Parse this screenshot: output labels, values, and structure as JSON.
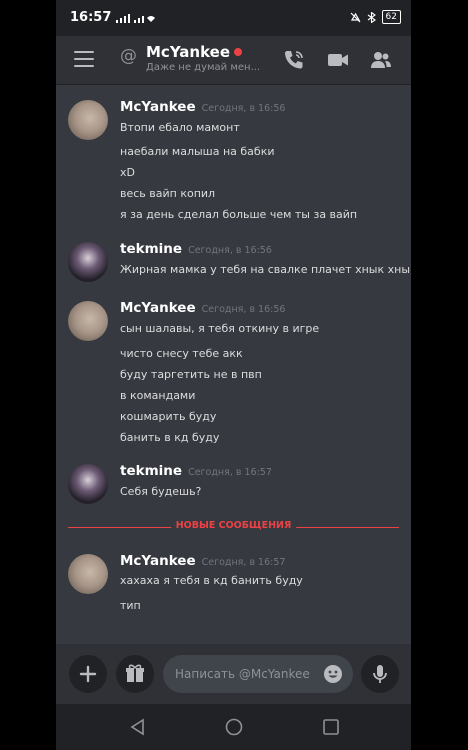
{
  "status_bar": {
    "time": "16:57",
    "battery": "62"
  },
  "header": {
    "at_symbol": "@",
    "username": "McYankee",
    "status_text": "Даже не думай мен..."
  },
  "messages": [
    {
      "author": "McYankee",
      "timestamp": "Сегодня, в 16:56",
      "avatar": "mcyankee-avatar",
      "lines": [
        "Втопи ебало мамонт",
        "наебали малыша на бабки",
        "xD",
        "весь вайп копил",
        "я за день сделал больше чем ты за вайп"
      ]
    },
    {
      "author": "tekmine",
      "timestamp": "Сегодня, в 16:56",
      "avatar": "tekmine-avatar",
      "lines": [
        "Жирная мамка у тебя на свалке плачет хнык хнык"
      ]
    },
    {
      "author": "McYankee",
      "timestamp": "Сегодня, в 16:56",
      "avatar": "mcyankee-avatar",
      "lines": [
        "сын шалавы, я тебя откину в игре",
        "чисто снесу тебе акк",
        "буду таргетить не в пвп",
        "в командами",
        "кошмарить буду",
        "банить в кд буду"
      ]
    },
    {
      "author": "tekmine",
      "timestamp": "Сегодня, в 16:57",
      "avatar": "tekmine-avatar",
      "lines": [
        "Себя будешь?"
      ]
    },
    {
      "author": "McYankee",
      "timestamp": "Сегодня, в 16:57",
      "avatar": "mcyankee-avatar",
      "lines": [
        "хахаха я тебя в кд банить буду",
        "тип"
      ]
    }
  ],
  "new_messages_divider": "НОВЫЕ СООБЩЕНИЯ",
  "composer": {
    "placeholder": "Написать @McYankee"
  },
  "colors": {
    "background": "#36393f",
    "header": "#2f3136",
    "dnd": "#ed4245",
    "divider": "#ed4245"
  },
  "icons": {
    "header": [
      "menu-icon",
      "phone-call-icon",
      "video-icon",
      "members-icon"
    ],
    "composer": [
      "plus-icon",
      "gift-icon",
      "emoji-icon",
      "microphone-icon"
    ],
    "nav": [
      "back-icon",
      "home-icon",
      "recents-icon"
    ]
  }
}
